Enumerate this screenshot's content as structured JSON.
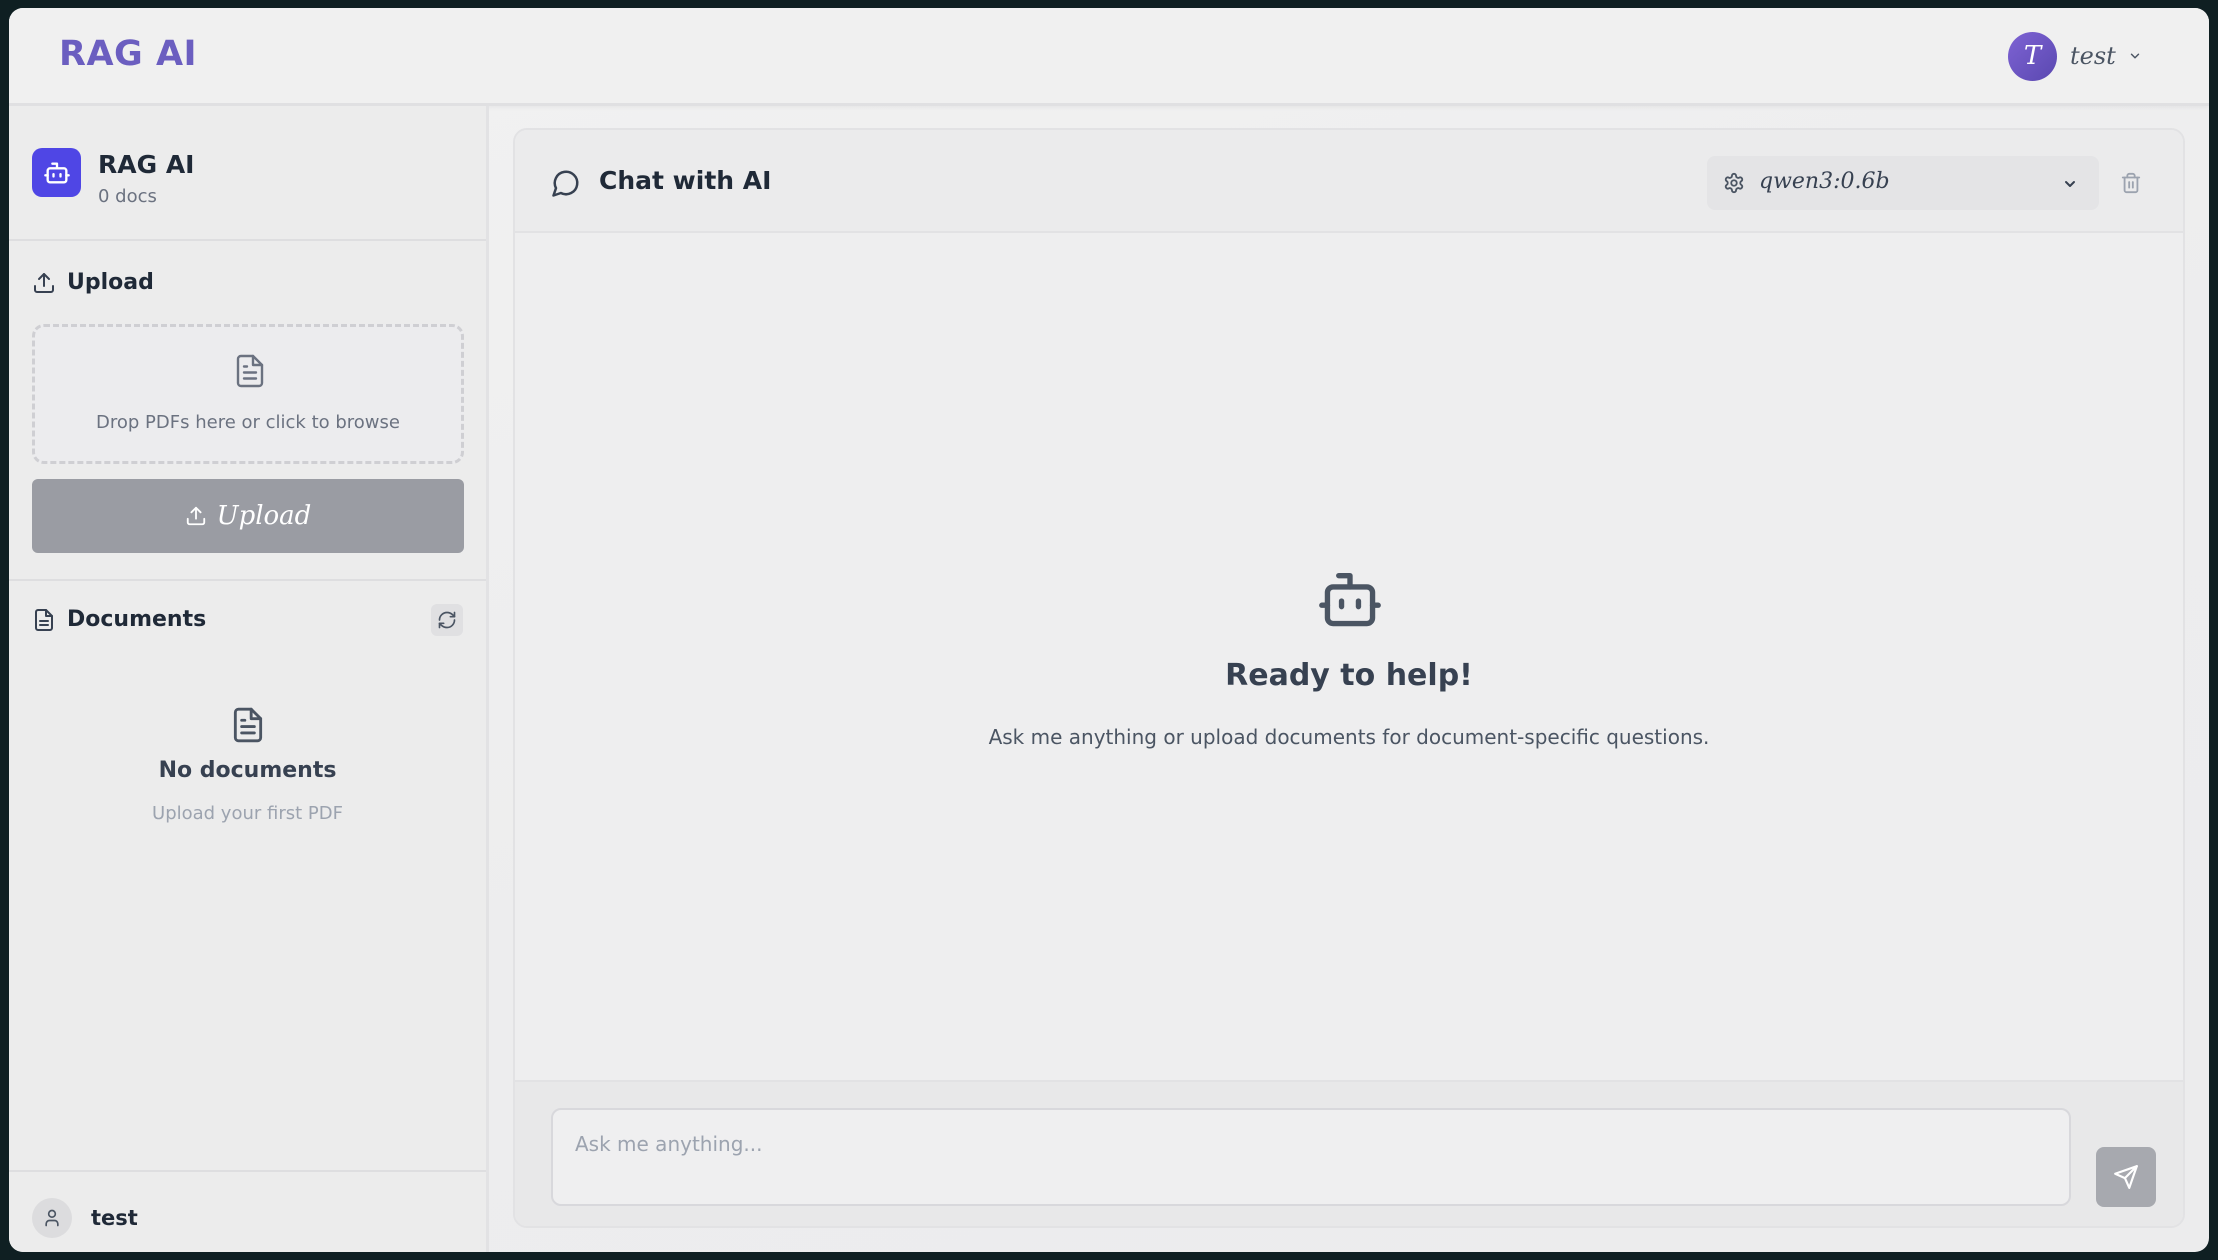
{
  "header": {
    "brand": "RAG AI",
    "user": {
      "initial": "T",
      "name": "test",
      "menu_icon": "chevron-down-icon"
    }
  },
  "sidebar": {
    "app_name": "RAG AI",
    "doc_count": "0 docs",
    "upload": {
      "heading": "Upload",
      "dropzone_text": "Drop PDFs here or click to browse",
      "button_label": "Upload"
    },
    "documents": {
      "heading": "Documents",
      "empty_title": "No documents",
      "empty_subtitle": "Upload your first PDF"
    },
    "footer": {
      "username": "test"
    }
  },
  "chat": {
    "title": "Chat with AI",
    "model": "qwen3:0.6b",
    "welcome_title": "Ready to help!",
    "welcome_subtitle": "Ask me anything or upload documents for document-specific questions.",
    "input_placeholder": "Ask me anything..."
  },
  "colors": {
    "brand": "#6b5ec0",
    "accent": "#4f46e5",
    "disabled_button": "#9a9ca3"
  }
}
